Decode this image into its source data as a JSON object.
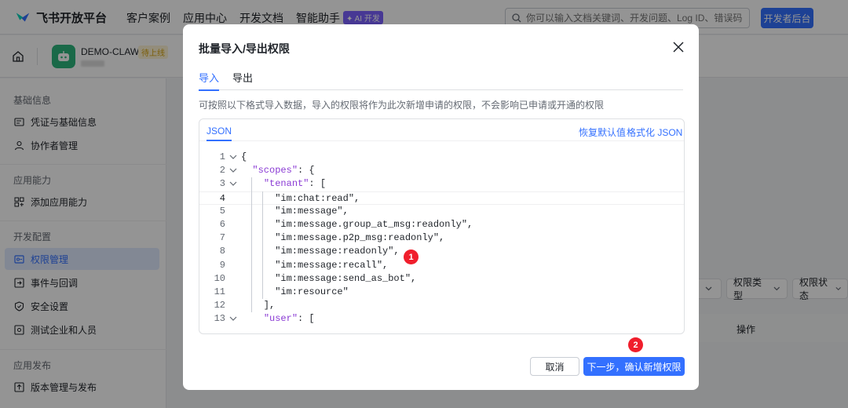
{
  "topnav": {
    "logo_text": "飞书开放平台",
    "items": [
      "客户案例",
      "应用中心",
      "开发文档",
      "智能助手"
    ],
    "ai_badge": "✦ AI 开发",
    "search_placeholder": "你可以输入文档关键词、开发问题、Log ID、错误码",
    "dev_console_button": "开发者后台"
  },
  "app": {
    "name": "DEMO-CLAW",
    "status": "待上线"
  },
  "sidebar": {
    "groups": [
      {
        "title": "基础信息",
        "items": [
          "凭证与基础信息",
          "协作者管理"
        ]
      },
      {
        "title": "应用能力",
        "items": [
          "添加应用能力"
        ]
      },
      {
        "title": "开发配置",
        "items": [
          "权限管理",
          "事件与回调",
          "安全设置",
          "测试企业和人员"
        ]
      },
      {
        "title": "应用发布",
        "items": [
          "版本管理与发布"
        ]
      }
    ],
    "active_item": "权限管理"
  },
  "background": {
    "filters": [
      "权限类型",
      "权限状态"
    ],
    "table_header_ops": "操作"
  },
  "modal": {
    "title": "批量导入/导出权限",
    "tabs": [
      "导入",
      "导出"
    ],
    "active_tab": "导入",
    "description": "可按照以下格式导入数据，导入的权限将作为此次新增申请的权限，不会影响已申请或开通的权限",
    "editor": {
      "tab": "JSON",
      "restore_default": "恢复默认值",
      "format_json": "格式化 JSON",
      "current_line": 4,
      "lines": [
        {
          "n": "1",
          "text": "{"
        },
        {
          "n": "2",
          "text": "  \"scopes\": {"
        },
        {
          "n": "3",
          "text": "    \"tenant\": ["
        },
        {
          "n": "4",
          "text": "      \"im:chat:read\","
        },
        {
          "n": "5",
          "text": "      \"im:message\","
        },
        {
          "n": "6",
          "text": "      \"im:message.group_at_msg:readonly\","
        },
        {
          "n": "7",
          "text": "      \"im:message.p2p_msg:readonly\","
        },
        {
          "n": "8",
          "text": "      \"im:message:readonly\","
        },
        {
          "n": "9",
          "text": "      \"im:message:recall\","
        },
        {
          "n": "10",
          "text": "      \"im:message:send_as_bot\","
        },
        {
          "n": "11",
          "text": "      \"im:resource\""
        },
        {
          "n": "12",
          "text": "    ],"
        },
        {
          "n": "13",
          "text": "    \"user\": ["
        }
      ]
    },
    "cancel_button": "取消",
    "next_button": "下一步，确认新增权限"
  },
  "annotations": [
    "1",
    "2"
  ],
  "colors": {
    "accent": "#3370ff",
    "badge": "#f01e2c",
    "app_icon": "#2eb67d"
  }
}
